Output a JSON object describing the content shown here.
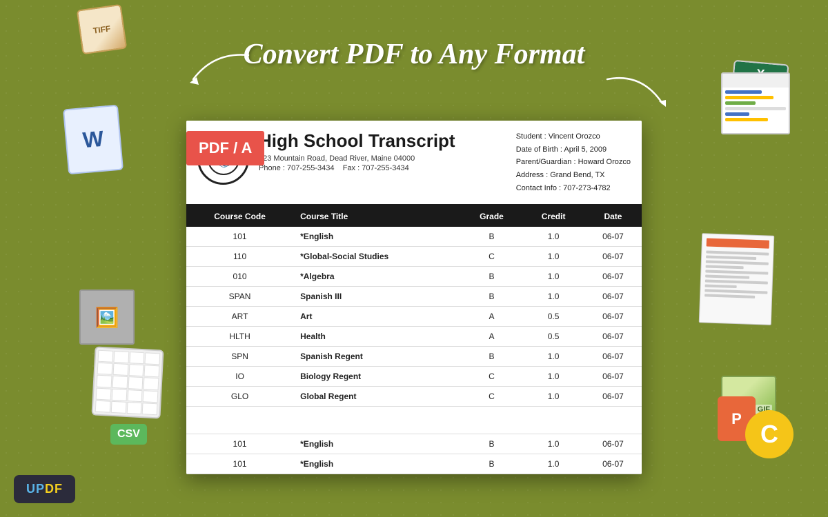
{
  "hero": {
    "title": "Convert PDF to Any Format"
  },
  "pdf_badge": "PDF / A",
  "transcript": {
    "title": "High School Transcript",
    "address": "123 Mountain Road, Dead River, Maine 04000",
    "phone": "Phone : 707-255-3434",
    "fax": "Fax : 707-255-3434",
    "student": "Student : Vincent Orozco",
    "dob": "Date of Birth : April 5,  2009",
    "guardian": "Parent/Guardian : Howard Orozco",
    "address2": "Address : Grand Bend, TX",
    "contact": "Contact Info : 707-273-4782"
  },
  "table": {
    "headers": [
      "Course Code",
      "Course Title",
      "Grade",
      "Credit",
      "Date"
    ],
    "rows": [
      {
        "code": "101",
        "title": "*English",
        "grade": "B",
        "credit": "1.0",
        "date": "06-07"
      },
      {
        "code": "110",
        "title": "*Global-Social Studies",
        "grade": "C",
        "credit": "1.0",
        "date": "06-07"
      },
      {
        "code": "010",
        "title": "*Algebra",
        "grade": "B",
        "credit": "1.0",
        "date": "06-07"
      },
      {
        "code": "SPAN",
        "title": "Spanish III",
        "grade": "B",
        "credit": "1.0",
        "date": "06-07"
      },
      {
        "code": "ART",
        "title": "Art",
        "grade": "A",
        "credit": "0.5",
        "date": "06-07"
      },
      {
        "code": "HLTH",
        "title": "Health",
        "grade": "A",
        "credit": "0.5",
        "date": "06-07"
      },
      {
        "code": "SPN",
        "title": "Spanish Regent",
        "grade": "B",
        "credit": "1.0",
        "date": "06-07"
      },
      {
        "code": "IO",
        "title": "Biology Regent",
        "grade": "C",
        "credit": "1.0",
        "date": "06-07"
      },
      {
        "code": "GLO",
        "title": "Global Regent",
        "grade": "C",
        "credit": "1.0",
        "date": "06-07"
      },
      {
        "code": "",
        "title": "",
        "grade": "",
        "credit": "",
        "date": ""
      },
      {
        "code": "101",
        "title": "*English",
        "grade": "B",
        "credit": "1.0",
        "date": "06-07"
      },
      {
        "code": "101",
        "title": "*English",
        "grade": "B",
        "credit": "1.0",
        "date": "06-07"
      }
    ]
  },
  "updf": {
    "label_up": "UP",
    "label_df": "DF"
  },
  "icons": {
    "tiff_label": "TIFF",
    "word_label": "W",
    "excel_label": "X",
    "csv_label": "CSV",
    "ppt_label": "P",
    "c_label": "C"
  }
}
